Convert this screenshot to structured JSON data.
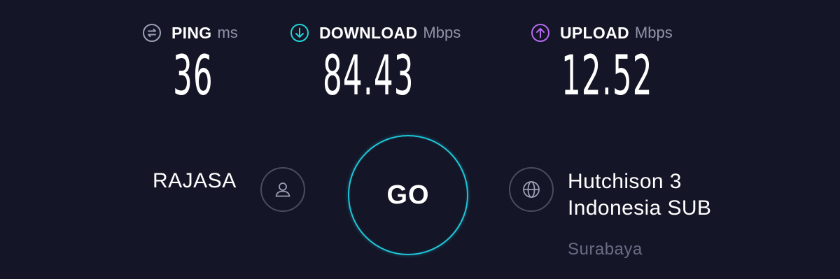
{
  "metrics": {
    "ping": {
      "label": "PING",
      "unit": "ms",
      "value": "36",
      "icon": "ping-icon",
      "color": "#9c9eb4"
    },
    "download": {
      "label": "DOWNLOAD",
      "unit": "Mbps",
      "value": "84.43",
      "icon": "download-arrow-icon",
      "color": "#1fd3d4"
    },
    "upload": {
      "label": "UPLOAD",
      "unit": "Mbps",
      "value": "12.52",
      "icon": "upload-arrow-icon",
      "color": "#b36af0"
    }
  },
  "user": {
    "name": "RAJASA",
    "icon": "user-icon"
  },
  "go_button": {
    "label": "GO",
    "ring_color": "#1fc5d8"
  },
  "server": {
    "icon": "globe-icon",
    "name_line1": "Hutchison 3",
    "name_line2": "Indonesia SUB",
    "location": "Surabaya"
  },
  "theme": {
    "background": "#141526",
    "muted_text": "#9193a8",
    "location_text": "#6a6c84"
  }
}
